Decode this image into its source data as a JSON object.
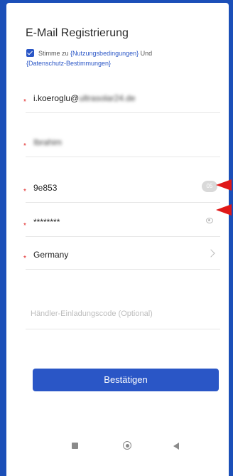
{
  "page": {
    "title": "E-Mail Registrierung"
  },
  "consent": {
    "checked": true,
    "text_prefix": "Stimme zu",
    "terms_link": "{Nutzungsbedingungen}",
    "connector": "Und",
    "privacy_link": "{Datenschutz-Bestimmungen}"
  },
  "fields": {
    "email": {
      "value_visible": "i.koeroglu@",
      "value_blurred": "ultrasolar24.de",
      "required": true
    },
    "name": {
      "value_blurred": "Ibrahim",
      "required": true
    },
    "verification_code": {
      "value": "9e853",
      "captcha_label": "05",
      "required": true
    },
    "password": {
      "value": "********",
      "required": true
    },
    "country": {
      "value": "Germany",
      "required": true
    },
    "invitation_code": {
      "placeholder": "Händler-Einladungscode (Optional)"
    }
  },
  "confirm_button": {
    "label": "Bestätigen"
  },
  "required_marker": "*",
  "annotations": {
    "arrow_color": "#e01818"
  },
  "colors": {
    "accent": "#2a56c6",
    "frame": "#1b4fb8"
  },
  "system_nav": {
    "icons": [
      "recent-apps-icon",
      "home-icon",
      "back-icon"
    ]
  }
}
